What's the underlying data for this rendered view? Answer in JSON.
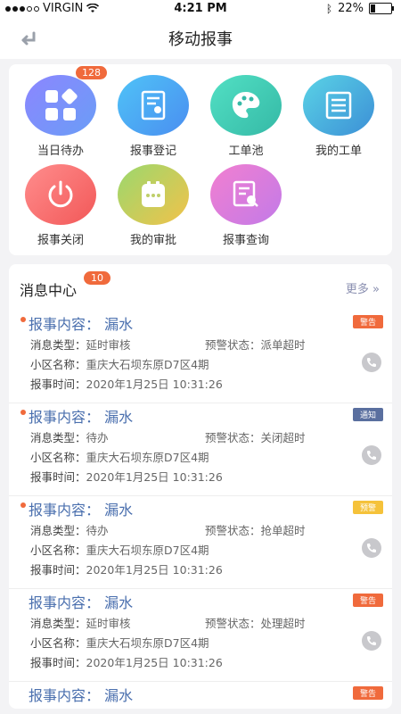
{
  "status": {
    "carrier": "VIRGIN",
    "time": "4:21 PM",
    "battery": "22%"
  },
  "nav": {
    "title": "移动报事"
  },
  "grid": [
    {
      "label": "当日待办",
      "badge": "128"
    },
    {
      "label": "报事登记"
    },
    {
      "label": "工单池"
    },
    {
      "label": "我的工单"
    },
    {
      "label": "报事关闭"
    },
    {
      "label": "我的审批"
    },
    {
      "label": "报事查询"
    }
  ],
  "messages": {
    "title": "消息中心",
    "count": "10",
    "more": "更多 »",
    "items": [
      {
        "content": "报事内容： 漏水",
        "tag": "警告",
        "tag_color": "#f06a3c",
        "dot": true,
        "type_label": "消息类型：",
        "type": "延时审核",
        "alert_label": "预警状态：",
        "alert": "派单超时",
        "area_label": "小区名称：",
        "area": "重庆大石坝东原D7区4期",
        "time_label": "报事时间：",
        "time": "2020年1月25日 10:31:26"
      },
      {
        "content": "报事内容： 漏水",
        "tag": "通知",
        "tag_color": "#5a6f9f",
        "dot": true,
        "type_label": "消息类型：",
        "type": "待办",
        "alert_label": "预警状态：",
        "alert": "关闭超时",
        "area_label": "小区名称：",
        "area": "重庆大石坝东原D7区4期",
        "time_label": "报事时间：",
        "time": "2020年1月25日 10:31:26"
      },
      {
        "content": "报事内容： 漏水",
        "tag": "预警",
        "tag_color": "#f5c23a",
        "dot": true,
        "type_label": "消息类型：",
        "type": "待办",
        "alert_label": "预警状态：",
        "alert": "抢单超时",
        "area_label": "小区名称：",
        "area": "重庆大石坝东原D7区4期",
        "time_label": "报事时间：",
        "time": "2020年1月25日 10:31:26"
      },
      {
        "content": "报事内容： 漏水",
        "tag": "警告",
        "tag_color": "#f06a3c",
        "dot": false,
        "type_label": "消息类型：",
        "type": "延时审核",
        "alert_label": "预警状态：",
        "alert": "处理超时",
        "area_label": "小区名称：",
        "area": "重庆大石坝东原D7区4期",
        "time_label": "报事时间：",
        "time": "2020年1月25日 10:31:26"
      },
      {
        "content": "报事内容： 漏水",
        "tag": "警告",
        "tag_color": "#f06a3c",
        "dot": false
      }
    ]
  }
}
